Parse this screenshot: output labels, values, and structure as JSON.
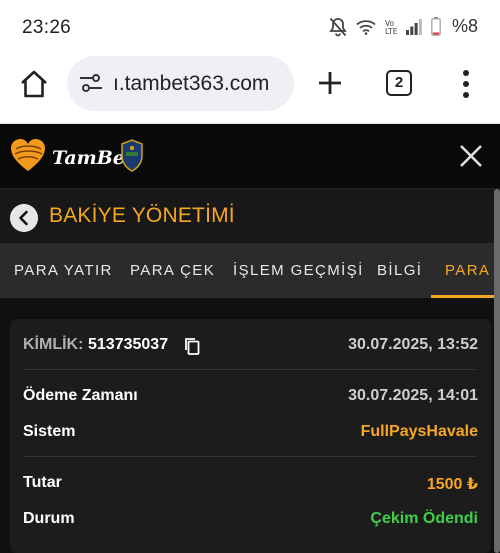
{
  "status_bar": {
    "time": "23:26",
    "icons": [
      "mute-icon",
      "wifi-icon",
      "volte-icon",
      "signal-icon",
      "battery-icon"
    ],
    "battery_percent": "%8"
  },
  "browser": {
    "url": "ı.tambet363.com",
    "tab_count": "2"
  },
  "site": {
    "logo_text": "TamBet",
    "section_title": "BAKİYE YÖNETİMİ",
    "tabs": [
      {
        "label": "PARA YATIR",
        "active": false
      },
      {
        "label": "PARA ÇEK",
        "active": false
      },
      {
        "label": "İŞLEM GEÇMİŞİ",
        "active": false
      },
      {
        "label": "BİLGİ",
        "active": false
      },
      {
        "label": "PARA Ç",
        "active": true
      }
    ],
    "card": {
      "kimlik_label": "KİMLİK:",
      "kimlik_value": "513735037",
      "created_at": "30.07.2025, 13:52",
      "payment_time_label": "Ödeme Zamanı",
      "payment_time_value": "30.07.2025, 14:01",
      "system_label": "Sistem",
      "system_value": "FullPaysHavale",
      "amount_label": "Tutar",
      "amount_value": "1500 ₺",
      "status_label": "Durum",
      "status_value": "Çekim Ödendi"
    }
  },
  "colors": {
    "accent": "#f6a623",
    "success": "#3fcf4a",
    "background": "#101010"
  }
}
